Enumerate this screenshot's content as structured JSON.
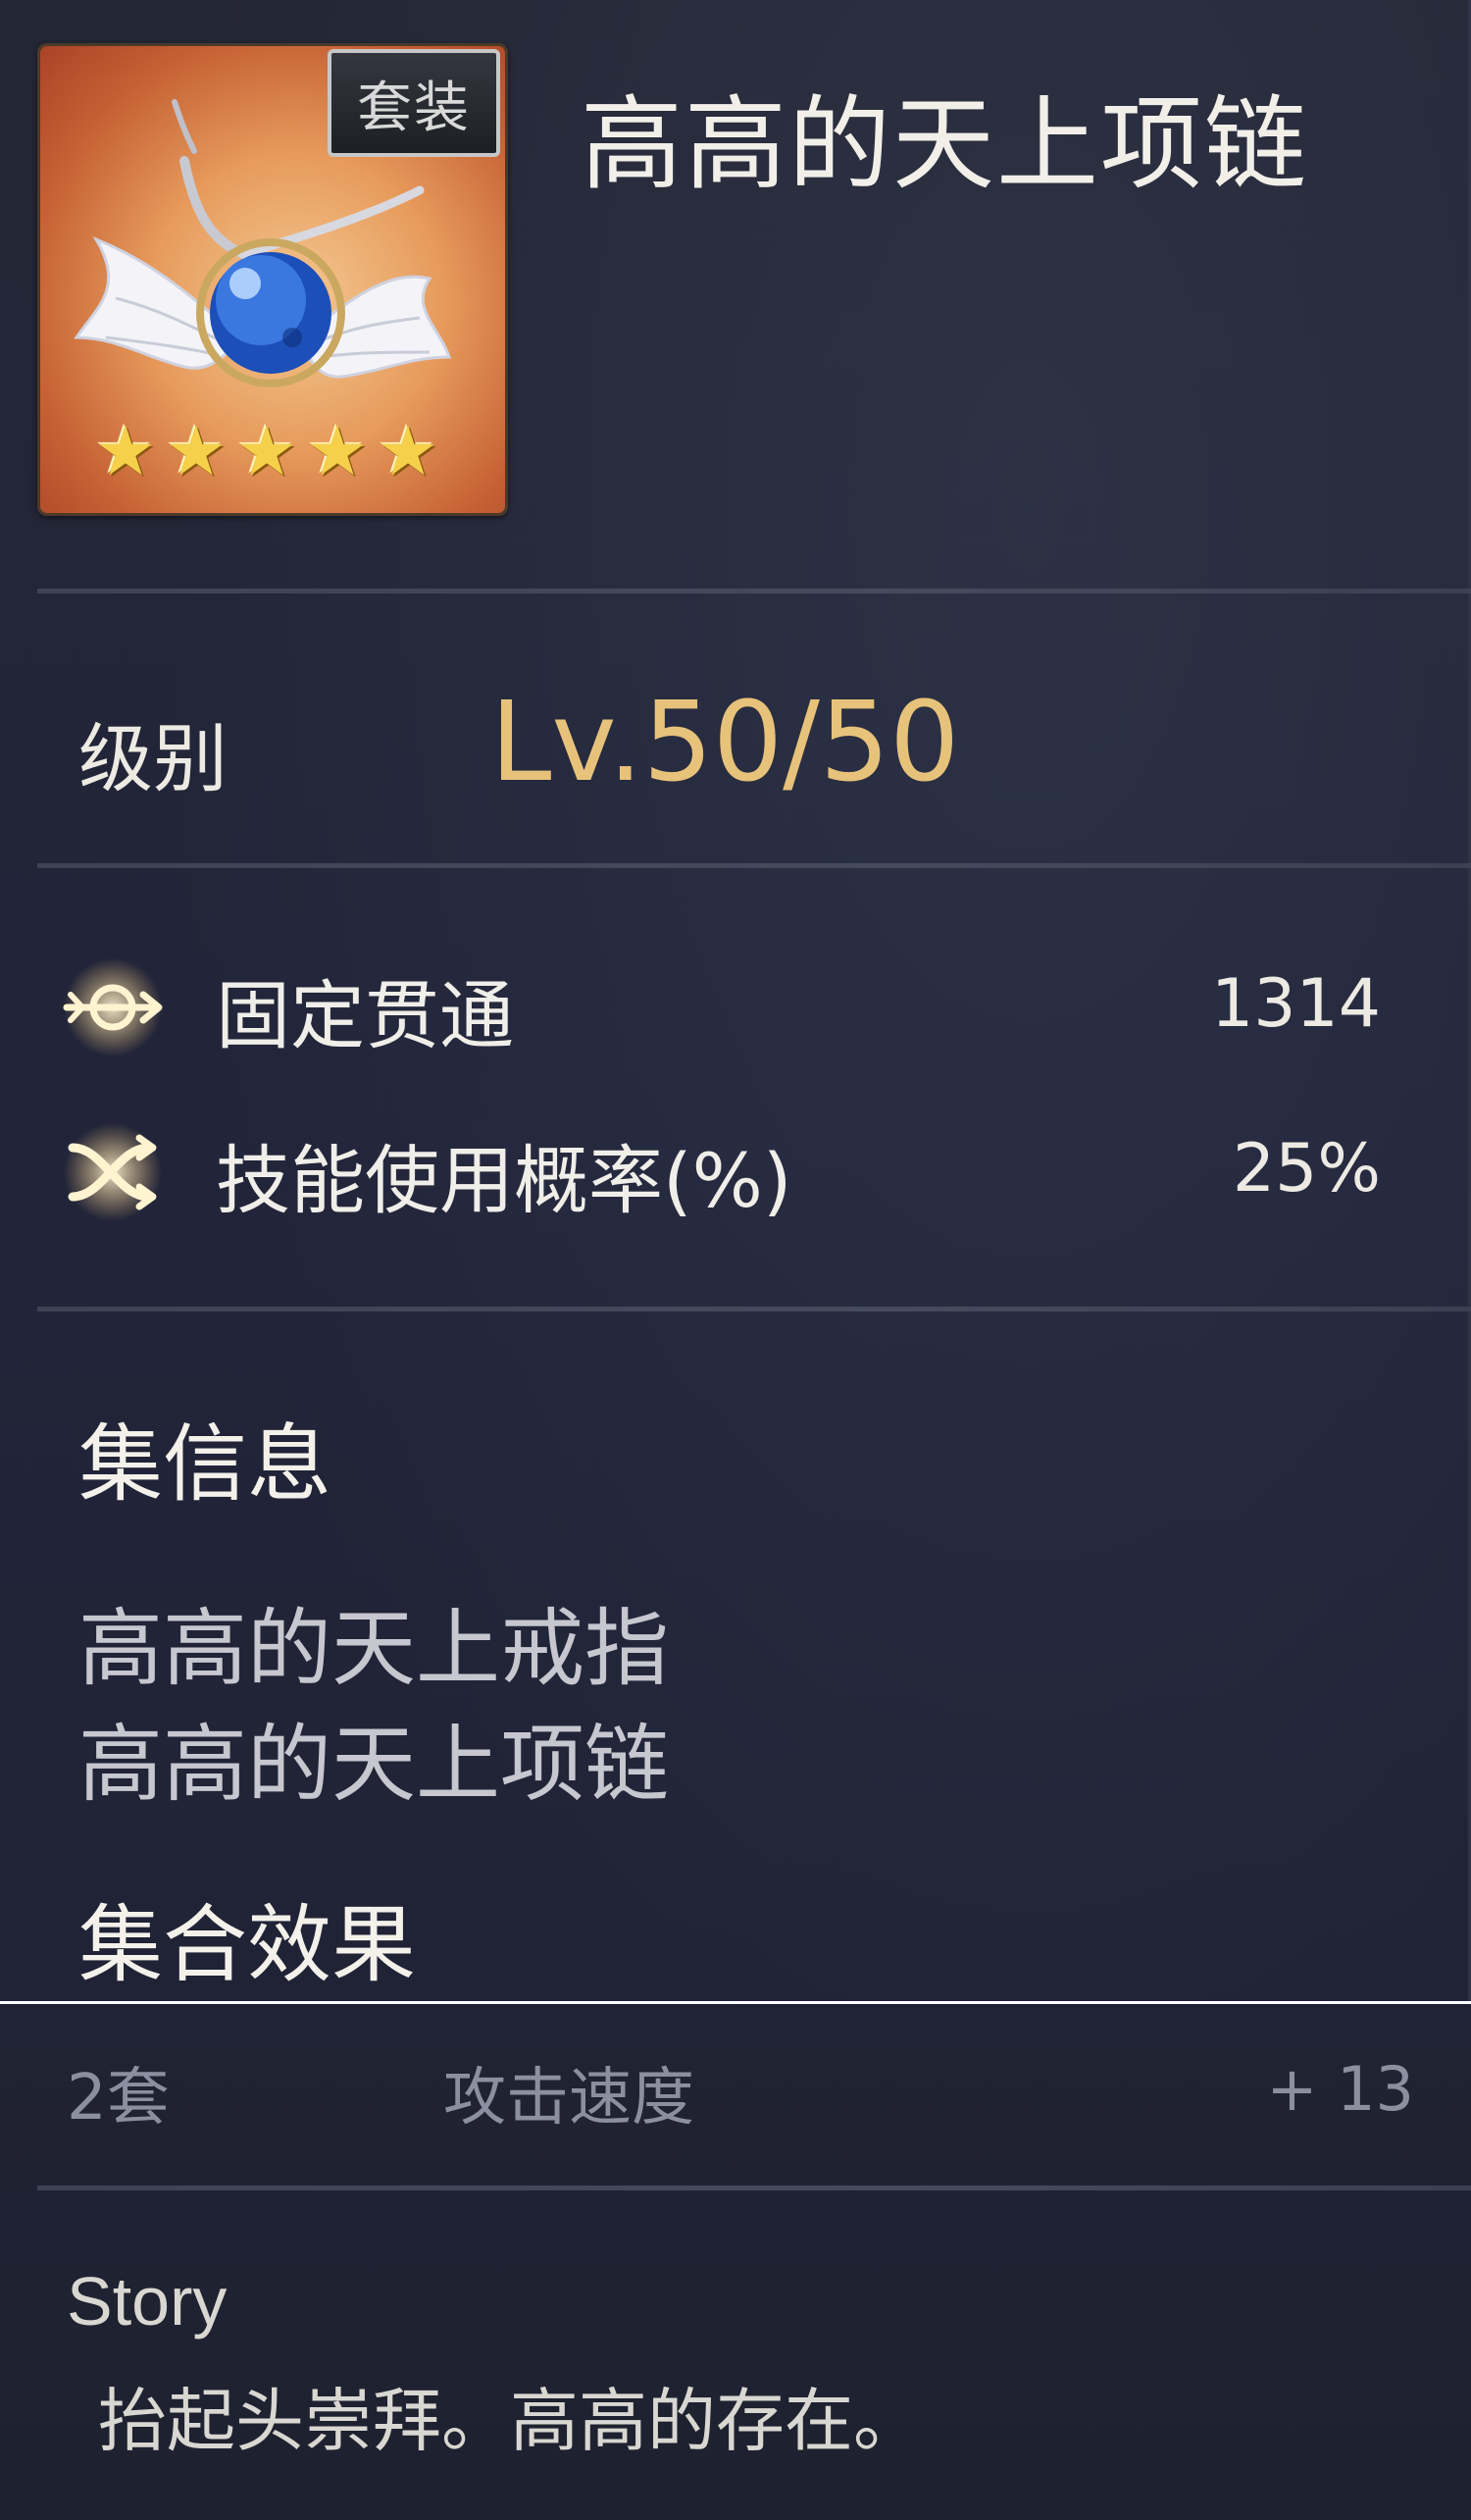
{
  "item": {
    "name": "高高的天上项链",
    "badge": "套装",
    "stars": [
      "★",
      "★",
      "★",
      "★",
      "★"
    ],
    "star_rating": 5,
    "icon_name": "necklace-item-icon",
    "frame_color": "#e08a4d"
  },
  "level": {
    "label": "级别",
    "value": "Lv.50/50",
    "value_color": "#e7c27a"
  },
  "stats": [
    {
      "icon": "penetration-icon",
      "label": "固定贯通",
      "value": "1314"
    },
    {
      "icon": "crossed-arrows-icon",
      "label": "技能使用概率(%)",
      "value": "25%"
    }
  ],
  "set_info": {
    "heading": "集信息",
    "pieces": [
      "高高的天上戒指",
      "高高的天上项链"
    ]
  },
  "set_effect": {
    "heading": "集合效果",
    "bonus": {
      "count": "2套",
      "stat": "攻击速度",
      "value": "+ 13"
    }
  },
  "story": {
    "title": "Story",
    "text": "抬起头崇拜。高高的存在。"
  }
}
